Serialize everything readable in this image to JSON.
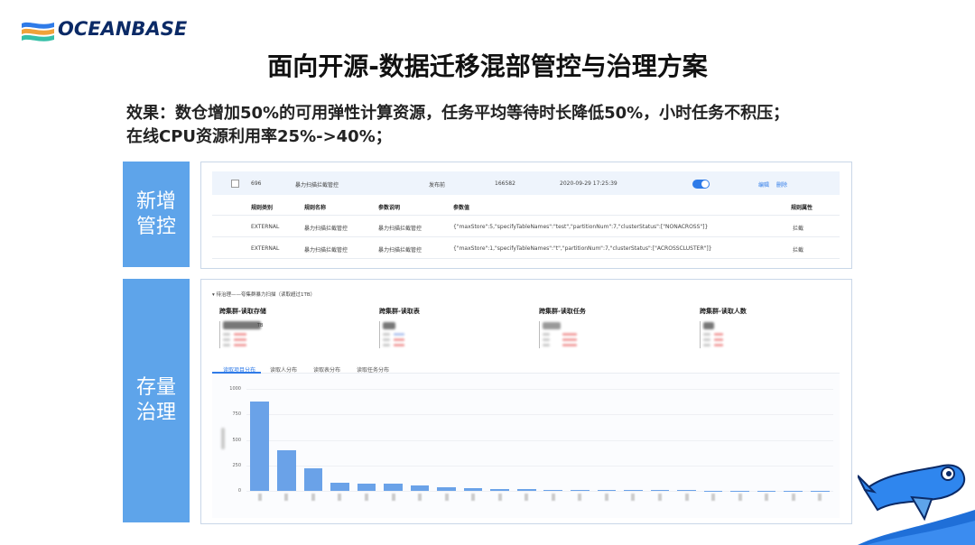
{
  "brand": {
    "name": "OCEANBASE"
  },
  "slide": {
    "title": "面向开源-数据迁移混部管控与治理方案",
    "subtitle_line1": "效果：数仓增加50%的可用弹性计算资源，任务平均等待时长降低50%，小时任务不积压；",
    "subtitle_line2": "在线CPU资源利用率25%->40%；"
  },
  "labels": {
    "new_control_line1": "新增",
    "new_control_line2": "管控",
    "storage_gov_line1": "存量",
    "storage_gov_line2": "治理"
  },
  "control_table": {
    "top_row": {
      "id": "696",
      "name": "暴力扫描拦截管控",
      "status": "发布前",
      "number": "166582",
      "datetime": "2020-09-29 17:25:39",
      "enabled": true,
      "edit": "编辑",
      "delete": "删除"
    },
    "headers": [
      "规则类别",
      "规则名称",
      "参数说明",
      "参数值",
      "规则属性"
    ],
    "rows": [
      {
        "category": "EXTERNAL",
        "name": "暴力扫描拦截管控",
        "desc": "暴力扫描拦截管控",
        "value": "{\"maxStore\":5,\"specifyTableNames\":\"test\",\"partitionNum\":7,\"clusterStatus\":[\"NONACROSS\"]}",
        "attr": "拦截"
      },
      {
        "category": "EXTERNAL",
        "name": "暴力扫描拦截管控",
        "desc": "暴力扫描拦截管控",
        "value": "{\"maxStore\":1,\"specifyTableNames\":\"t\",\"partitionNum\":7,\"clusterStatus\":[\"ACROSSCLUSTER\"]}",
        "attr": "拦截"
      }
    ]
  },
  "governance": {
    "section_title": "▾ 待治理——夸集群暴力扫描（读取超过1TB）",
    "stats": [
      {
        "title": "跨集群-读取存储",
        "unit": "TB"
      },
      {
        "title": "跨集群-读取表"
      },
      {
        "title": "跨集群-读取任务"
      },
      {
        "title": "跨集群-读取人数"
      }
    ],
    "tabs": [
      "读取项目分布",
      "读取人分布",
      "读取表分布",
      "读取任务分布"
    ],
    "active_tab": 0
  },
  "chart_data": {
    "type": "bar",
    "ylim": [
      0,
      1000
    ],
    "yticks": [
      "1000",
      "750",
      "500",
      "250",
      "0"
    ],
    "values": [
      880,
      400,
      225,
      80,
      75,
      75,
      50,
      35,
      25,
      18,
      14,
      11,
      9,
      7,
      6,
      5,
      5,
      4,
      4,
      4,
      3,
      3
    ]
  },
  "colors": {
    "accent": "#5ea4ea",
    "bar": "#6aa2e8",
    "toggle": "#2f7be8"
  }
}
